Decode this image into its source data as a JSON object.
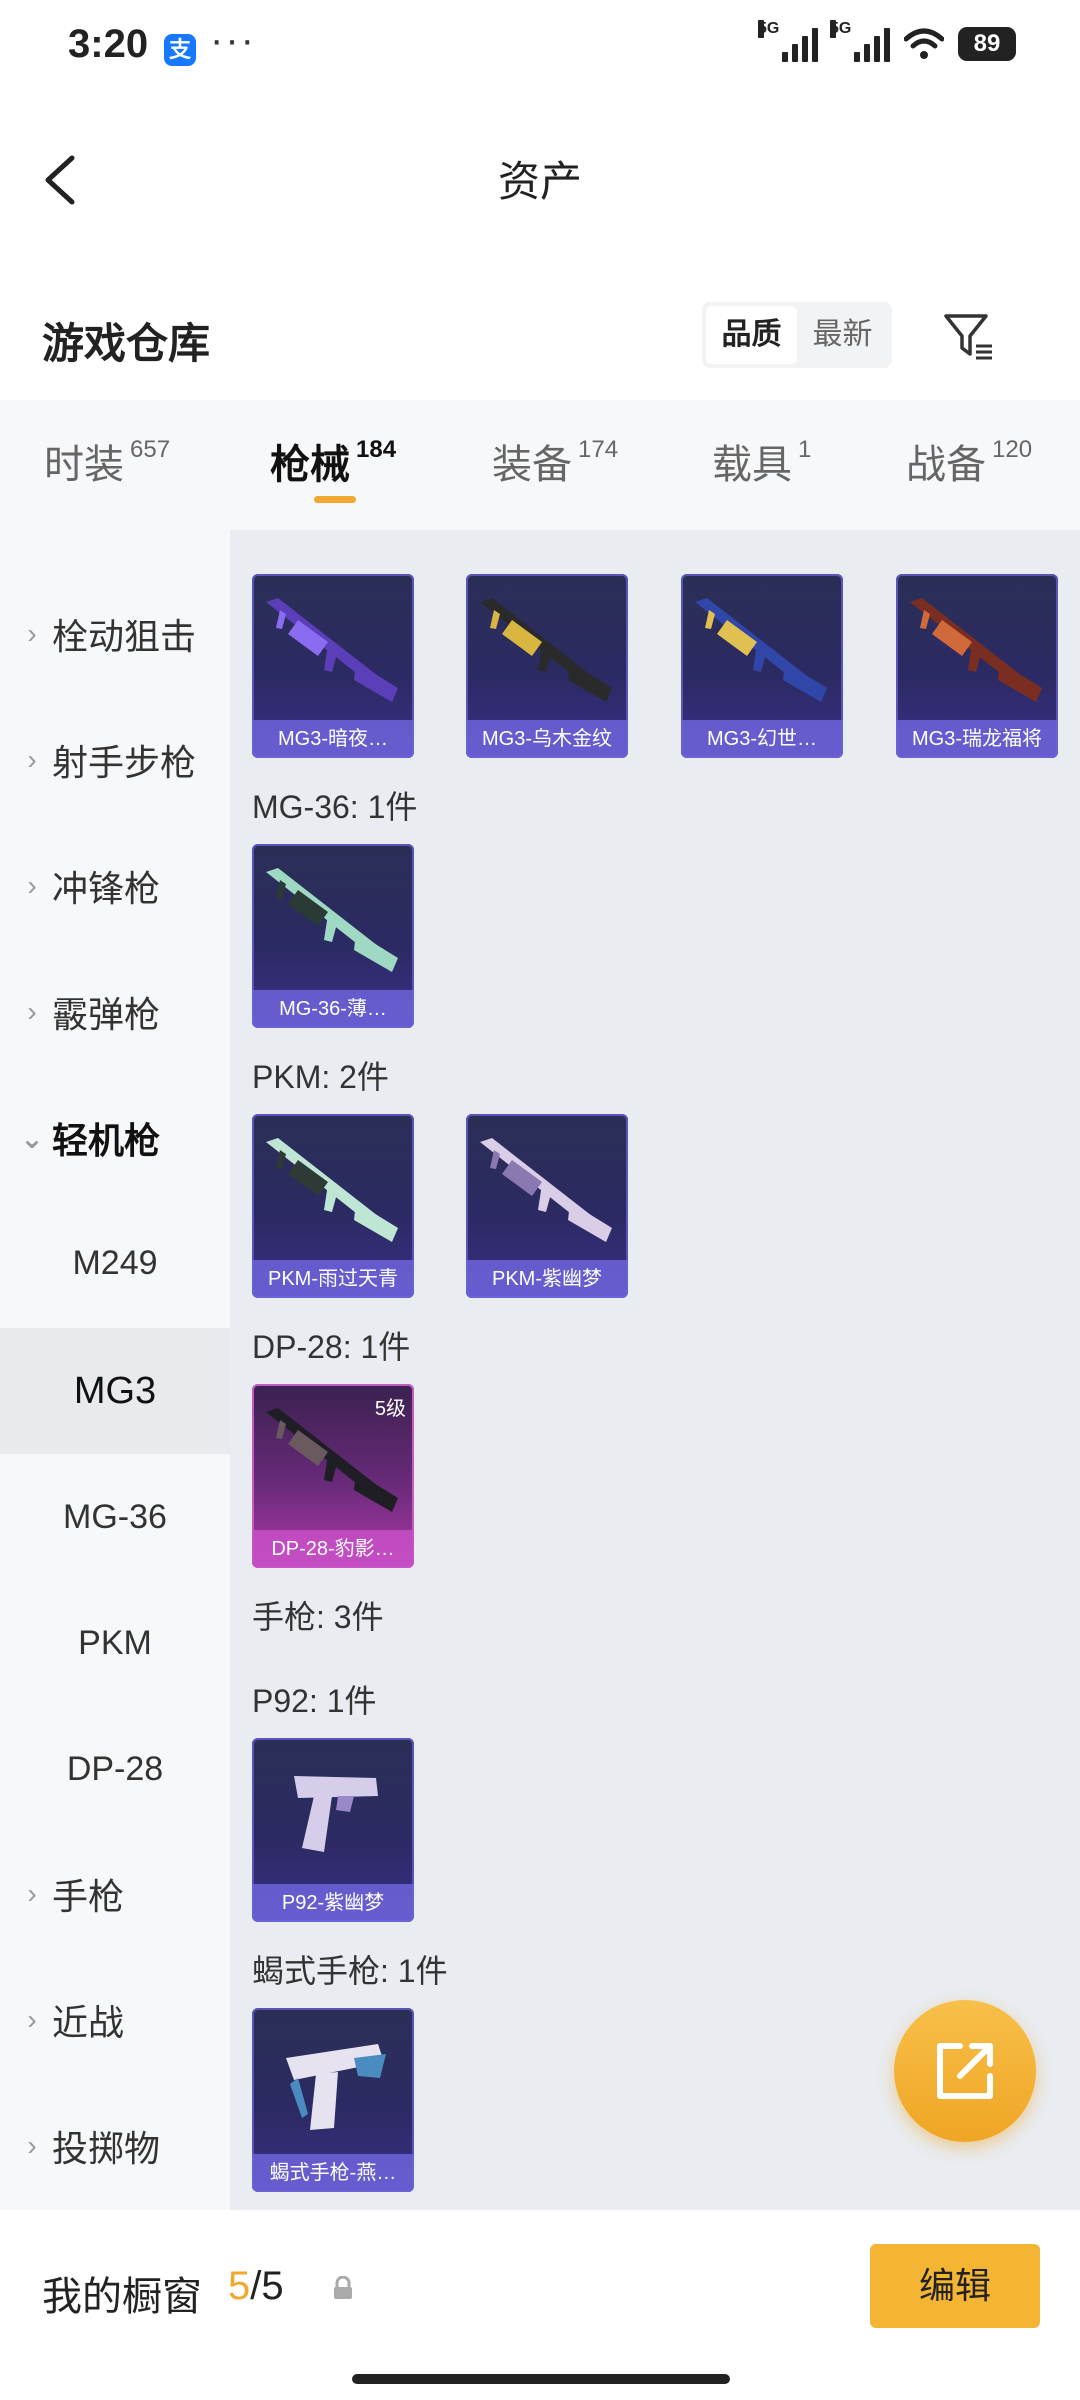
{
  "status_bar": {
    "time": "3:20",
    "pay_icon_text": "支",
    "more_dots": "···",
    "network_1": "5G",
    "network_2": "5G",
    "battery": "89"
  },
  "header": {
    "title": "资产"
  },
  "warehouse": {
    "title": "游戏仓库",
    "sort_options": [
      "品质",
      "最新"
    ],
    "sort_active": "品质"
  },
  "tabs": [
    {
      "label": "时装",
      "count": "657"
    },
    {
      "label": "枪械",
      "count": "184"
    },
    {
      "label": "装备",
      "count": "174"
    },
    {
      "label": "载具",
      "count": "1"
    },
    {
      "label": "战备",
      "count": "120"
    }
  ],
  "sidebar": {
    "categories": [
      {
        "label": "栓动狙击",
        "chevron": "›"
      },
      {
        "label": "射手步枪",
        "chevron": "›"
      },
      {
        "label": "冲锋枪",
        "chevron": "›"
      },
      {
        "label": "霰弹枪",
        "chevron": "›"
      },
      {
        "label": "轻机枪",
        "chevron": "⌄"
      }
    ],
    "subitems": [
      {
        "label": "M249"
      },
      {
        "label": "MG3"
      },
      {
        "label": "MG-36"
      },
      {
        "label": "PKM"
      },
      {
        "label": "DP-28"
      }
    ],
    "categories_after": [
      {
        "label": "手枪",
        "chevron": "›"
      },
      {
        "label": "近战",
        "chevron": "›"
      },
      {
        "label": "投掷物",
        "chevron": "›"
      }
    ]
  },
  "content": {
    "mg3_items": [
      {
        "name": "MG3-暗夜…",
        "gun_color": "#5a3fb8",
        "accent": "#8a6cf0"
      },
      {
        "name": "MG3-乌木金纹",
        "gun_color": "#2a2a2a",
        "accent": "#d8b640"
      },
      {
        "name": "MG3-幻世…",
        "gun_color": "#3046a8",
        "accent": "#e0c050"
      },
      {
        "name": "MG3-瑞龙福将",
        "gun_color": "#7a2e22",
        "accent": "#d06a3a"
      }
    ],
    "mg36_label": "MG-36: 1件",
    "mg36_items": [
      {
        "name": "MG-36-薄…",
        "gun_color": "#9fd9c4",
        "accent": "#2a3a34"
      }
    ],
    "pkm_label": "PKM: 2件",
    "pkm_items": [
      {
        "name": "PKM-雨过天青",
        "gun_color": "#bfe6d4",
        "accent": "#2e3a36"
      },
      {
        "name": "PKM-紫幽梦",
        "gun_color": "#d9cde8",
        "accent": "#8a78b0"
      }
    ],
    "dp28_label": "DP-28: 1件",
    "dp28_items": [
      {
        "name": "DP-28-豹影…",
        "level": "5级",
        "gun_color": "#1e1e24",
        "accent": "#6a5a60"
      }
    ],
    "pistol_label": "手枪: 3件",
    "p92_label": "P92: 1件",
    "p92_items": [
      {
        "name": "P92-紫幽梦",
        "gun_color": "#d6cdea",
        "accent": "#9a88c8"
      }
    ],
    "scorpion_label": "蝎式手枪: 1件",
    "scorpion_items": [
      {
        "name": "蝎式手枪-燕…",
        "gun_color": "#e6e2ef",
        "accent": "#4a8cc0"
      }
    ]
  },
  "bottom": {
    "showcase_label": "我的橱窗",
    "showcase_used": "5",
    "showcase_total": "/5",
    "edit_label": "编辑"
  }
}
